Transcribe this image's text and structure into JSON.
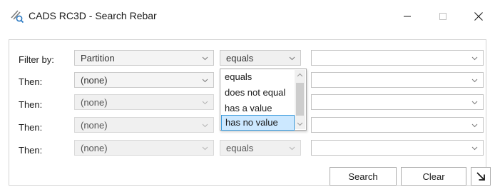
{
  "window": {
    "title": "CADS RC3D - Search Rebar",
    "icon": "cads-rc3d-app-icon",
    "controls": [
      "minimize-icon",
      "maximize-icon",
      "close-icon"
    ]
  },
  "filters": {
    "rows": [
      {
        "label": "Filter by:",
        "field": "Partition",
        "operator": "equals",
        "value": ""
      },
      {
        "label": "Then:",
        "field": "(none)",
        "operator": "",
        "value": ""
      },
      {
        "label": "Then:",
        "field": "(none)",
        "operator": "",
        "value": ""
      },
      {
        "label": "Then:",
        "field": "(none)",
        "operator": "",
        "value": ""
      },
      {
        "label": "Then:",
        "field": "(none)",
        "operator": "equals",
        "value": ""
      }
    ]
  },
  "operator_dropdown": {
    "options": [
      "equals",
      "does not equal",
      "has a value",
      "has no value"
    ],
    "selected": "has no value"
  },
  "buttons": {
    "search": "Search",
    "clear": "Clear",
    "expand_icon": "diagonal-arrow-icon"
  }
}
